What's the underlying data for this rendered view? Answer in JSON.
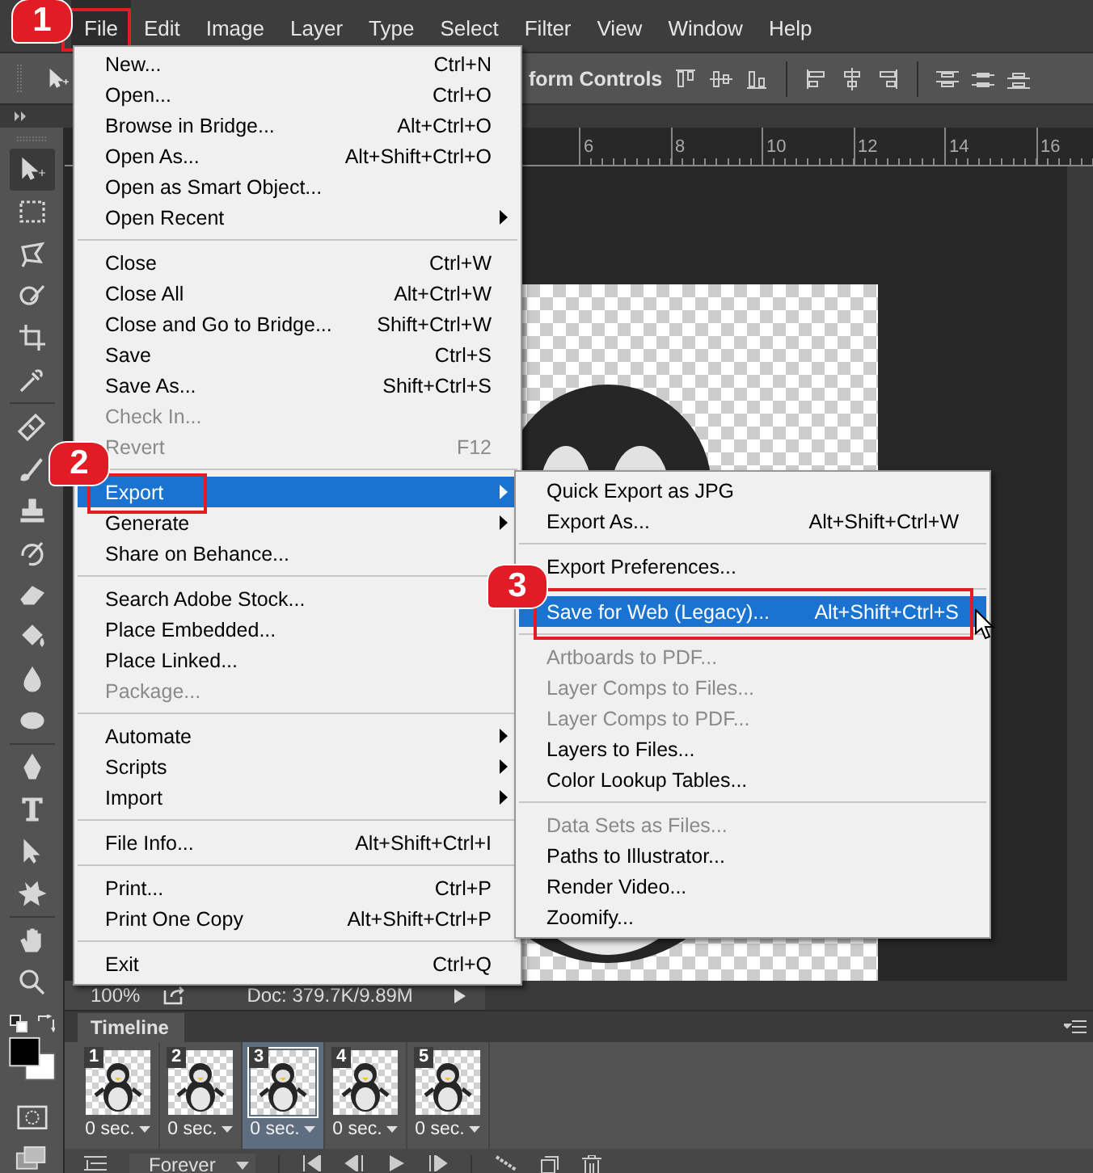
{
  "menubar": {
    "items": [
      {
        "label": "File",
        "selected": true,
        "callout": "1"
      },
      {
        "label": "Edit",
        "selected": false
      },
      {
        "label": "Image",
        "selected": false
      },
      {
        "label": "Layer",
        "selected": false
      },
      {
        "label": "Type",
        "selected": false
      },
      {
        "label": "Select",
        "selected": false
      },
      {
        "label": "Filter",
        "selected": false
      },
      {
        "label": "View",
        "selected": false
      },
      {
        "label": "Window",
        "selected": false
      },
      {
        "label": "Help",
        "selected": false
      }
    ]
  },
  "options_bar": {
    "text": "form Controls"
  },
  "ruler": {
    "labels": [
      "6",
      "8",
      "10",
      "12",
      "14",
      "16"
    ]
  },
  "file_menu": {
    "items": [
      {
        "kind": "item",
        "label": "New...",
        "shortcut": "Ctrl+N",
        "disabled": false,
        "submenu": false,
        "selected": false
      },
      {
        "kind": "item",
        "label": "Open...",
        "shortcut": "Ctrl+O",
        "disabled": false,
        "submenu": false,
        "selected": false
      },
      {
        "kind": "item",
        "label": "Browse in Bridge...",
        "shortcut": "Alt+Ctrl+O",
        "disabled": false,
        "submenu": false,
        "selected": false
      },
      {
        "kind": "item",
        "label": "Open As...",
        "shortcut": "Alt+Shift+Ctrl+O",
        "disabled": false,
        "submenu": false,
        "selected": false
      },
      {
        "kind": "item",
        "label": "Open as Smart Object...",
        "disabled": false,
        "submenu": false,
        "selected": false
      },
      {
        "kind": "item",
        "label": "Open Recent",
        "disabled": false,
        "submenu": true,
        "selected": false
      },
      {
        "kind": "separator"
      },
      {
        "kind": "item",
        "label": "Close",
        "shortcut": "Ctrl+W",
        "disabled": false,
        "submenu": false,
        "selected": false
      },
      {
        "kind": "item",
        "label": "Close All",
        "shortcut": "Alt+Ctrl+W",
        "disabled": false,
        "submenu": false,
        "selected": false
      },
      {
        "kind": "item",
        "label": "Close and Go to Bridge...",
        "shortcut": "Shift+Ctrl+W",
        "disabled": false,
        "submenu": false,
        "selected": false
      },
      {
        "kind": "item",
        "label": "Save",
        "shortcut": "Ctrl+S",
        "disabled": false,
        "submenu": false,
        "selected": false
      },
      {
        "kind": "item",
        "label": "Save As...",
        "shortcut": "Shift+Ctrl+S",
        "disabled": false,
        "submenu": false,
        "selected": false
      },
      {
        "kind": "item",
        "label": "Check In...",
        "disabled": true,
        "submenu": false,
        "selected": false
      },
      {
        "kind": "item",
        "label": "Revert",
        "shortcut": "F12",
        "disabled": true,
        "submenu": false,
        "selected": false
      },
      {
        "kind": "separator"
      },
      {
        "kind": "item",
        "label": "Export",
        "disabled": false,
        "submenu": true,
        "selected": true,
        "callout": "2"
      },
      {
        "kind": "item",
        "label": "Generate",
        "disabled": false,
        "submenu": true,
        "selected": false
      },
      {
        "kind": "item",
        "label": "Share on Behance...",
        "disabled": false,
        "submenu": false,
        "selected": false
      },
      {
        "kind": "separator"
      },
      {
        "kind": "item",
        "label": "Search Adobe Stock...",
        "disabled": false,
        "submenu": false,
        "selected": false
      },
      {
        "kind": "item",
        "label": "Place Embedded...",
        "disabled": false,
        "submenu": false,
        "selected": false
      },
      {
        "kind": "item",
        "label": "Place Linked...",
        "disabled": false,
        "submenu": false,
        "selected": false
      },
      {
        "kind": "item",
        "label": "Package...",
        "disabled": true,
        "submenu": false,
        "selected": false
      },
      {
        "kind": "separator"
      },
      {
        "kind": "item",
        "label": "Automate",
        "disabled": false,
        "submenu": true,
        "selected": false
      },
      {
        "kind": "item",
        "label": "Scripts",
        "disabled": false,
        "submenu": true,
        "selected": false
      },
      {
        "kind": "item",
        "label": "Import",
        "disabled": false,
        "submenu": true,
        "selected": false
      },
      {
        "kind": "separator"
      },
      {
        "kind": "item",
        "label": "File Info...",
        "shortcut": "Alt+Shift+Ctrl+I",
        "disabled": false,
        "submenu": false,
        "selected": false
      },
      {
        "kind": "separator"
      },
      {
        "kind": "item",
        "label": "Print...",
        "shortcut": "Ctrl+P",
        "disabled": false,
        "submenu": false,
        "selected": false
      },
      {
        "kind": "item",
        "label": "Print One Copy",
        "shortcut": "Alt+Shift+Ctrl+P",
        "disabled": false,
        "submenu": false,
        "selected": false
      },
      {
        "kind": "separator"
      },
      {
        "kind": "item",
        "label": "Exit",
        "shortcut": "Ctrl+Q",
        "disabled": false,
        "submenu": false,
        "selected": false
      }
    ]
  },
  "export_submenu": {
    "items": [
      {
        "kind": "item",
        "label": "Quick Export as JPG",
        "disabled": false,
        "selected": false
      },
      {
        "kind": "item",
        "label": "Export As...",
        "shortcut": "Alt+Shift+Ctrl+W",
        "disabled": false,
        "selected": false
      },
      {
        "kind": "separator"
      },
      {
        "kind": "item",
        "label": "Export Preferences...",
        "disabled": false,
        "selected": false
      },
      {
        "kind": "separator"
      },
      {
        "kind": "item",
        "label": "Save for Web (Legacy)...",
        "shortcut": "Alt+Shift+Ctrl+S",
        "disabled": false,
        "selected": true,
        "callout": "3"
      },
      {
        "kind": "separator"
      },
      {
        "kind": "item",
        "label": "Artboards to PDF...",
        "disabled": true,
        "selected": false
      },
      {
        "kind": "item",
        "label": "Layer Comps to Files...",
        "disabled": true,
        "selected": false
      },
      {
        "kind": "item",
        "label": "Layer Comps to PDF...",
        "disabled": true,
        "selected": false
      },
      {
        "kind": "item",
        "label": "Layers to Files...",
        "disabled": false,
        "selected": false
      },
      {
        "kind": "item",
        "label": "Color Lookup Tables...",
        "disabled": false,
        "selected": false
      },
      {
        "kind": "separator"
      },
      {
        "kind": "item",
        "label": "Data Sets as Files...",
        "disabled": true,
        "selected": false
      },
      {
        "kind": "item",
        "label": "Paths to Illustrator...",
        "disabled": false,
        "selected": false
      },
      {
        "kind": "item",
        "label": "Render Video...",
        "disabled": false,
        "selected": false
      },
      {
        "kind": "item",
        "label": "Zoomify...",
        "disabled": false,
        "selected": false
      }
    ]
  },
  "status_bar": {
    "zoom": "100%",
    "document": "Doc: 379.7K/9.89M"
  },
  "timeline": {
    "title": "Timeline",
    "frames": [
      {
        "number": "1",
        "delay": "0 sec.",
        "selected": false
      },
      {
        "number": "2",
        "delay": "0 sec.",
        "selected": false
      },
      {
        "number": "3",
        "delay": "0 sec.",
        "selected": true
      },
      {
        "number": "4",
        "delay": "0 sec.",
        "selected": false
      },
      {
        "number": "5",
        "delay": "0 sec.",
        "selected": false
      }
    ],
    "loop": "Forever"
  }
}
